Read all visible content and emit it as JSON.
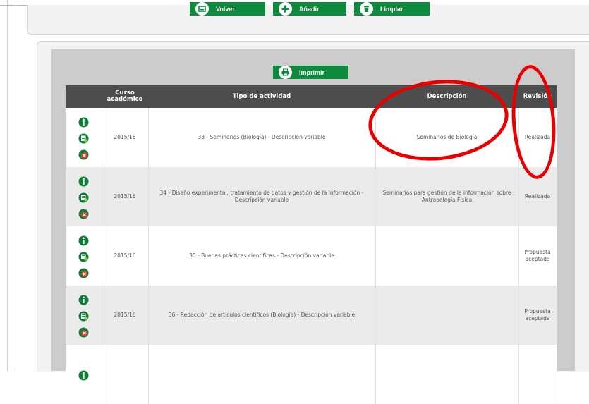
{
  "toolbar": {
    "volver_label": "Volver",
    "anadir_label": "Añadir",
    "limpiar_label": "Limpiar"
  },
  "print": {
    "label": "Imprimir"
  },
  "table": {
    "headers": {
      "icons": "",
      "curso": "Curso académico",
      "tipo": "Tipo de actividad",
      "descripcion": "Descripción",
      "revision": "Revisión"
    },
    "rows": [
      {
        "curso": "2015/16",
        "tipo": "33 - Seminarios (Biología) - Descripción variable",
        "descripcion": "Seminarios de Biología",
        "revision": "Realizada"
      },
      {
        "curso": "2015/16",
        "tipo": "34 - Diseño experimental, tratamiento de datos y gestión de la información - Descripción variable",
        "descripcion": "Seminarios para gestión de la información sobre Antropología Física",
        "revision": "Realizada"
      },
      {
        "curso": "2015/16",
        "tipo": "35 - Buenas prácticas científicas - Descripción variable",
        "descripcion": "",
        "revision": "Propuesta aceptada"
      },
      {
        "curso": "2015/16",
        "tipo": "36 - Redacción de artículos científicos (Biología) - Descripción variable",
        "descripcion": "",
        "revision": "Propuesta aceptada"
      },
      {
        "curso": "",
        "tipo": "",
        "descripcion": "",
        "revision": ""
      }
    ]
  },
  "colors": {
    "accent_green": "#0e8a3c",
    "header_dark": "#4d4d4d",
    "annotation_red": "#e80000"
  },
  "icons": [
    "back-icon",
    "plus-icon",
    "trash-icon",
    "printer-icon",
    "info-icon",
    "edit-icon",
    "delete-icon"
  ]
}
